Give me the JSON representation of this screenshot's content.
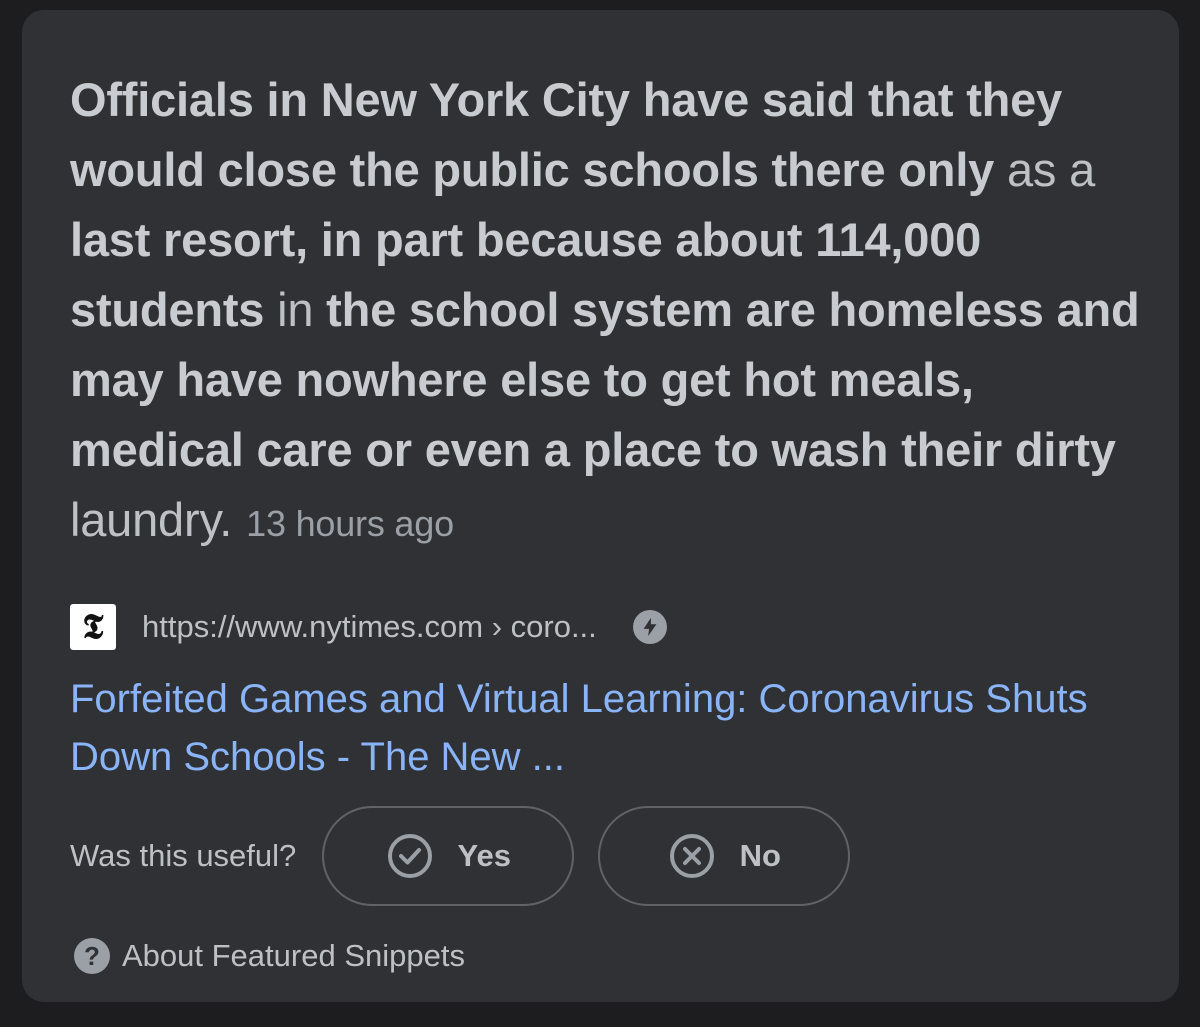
{
  "snippet": {
    "segments": [
      {
        "text": "Officials in New York City have said that they would close the public schools there only",
        "bold": true
      },
      {
        "text": " as a ",
        "bold": false
      },
      {
        "text": "last resort, in part because about 114,000 students",
        "bold": true
      },
      {
        "text": " in ",
        "bold": false
      },
      {
        "text": "the school system are homeless and may have nowhere else to get hot meals, medical care or even a place to wash their dirty",
        "bold": true
      },
      {
        "text": " laundry.",
        "bold": false
      }
    ],
    "timestamp": "13 hours ago"
  },
  "source": {
    "favicon_letter": "𝕿",
    "url": "https://www.nytimes.com › coro...",
    "amp_icon": "lightning-bolt-icon"
  },
  "result": {
    "title": "Forfeited Games and Virtual Learning: Coronavirus Shuts Down Schools - The New ..."
  },
  "feedback": {
    "question": "Was this useful?",
    "yes_label": "Yes",
    "no_label": "No"
  },
  "about": {
    "icon": "?",
    "label": "About Featured Snippets"
  },
  "colors": {
    "background": "#1d1d1f",
    "card": "#303134",
    "text": "#bdc1c6",
    "link": "#8ab4f8",
    "muted": "#9aa0a6"
  }
}
